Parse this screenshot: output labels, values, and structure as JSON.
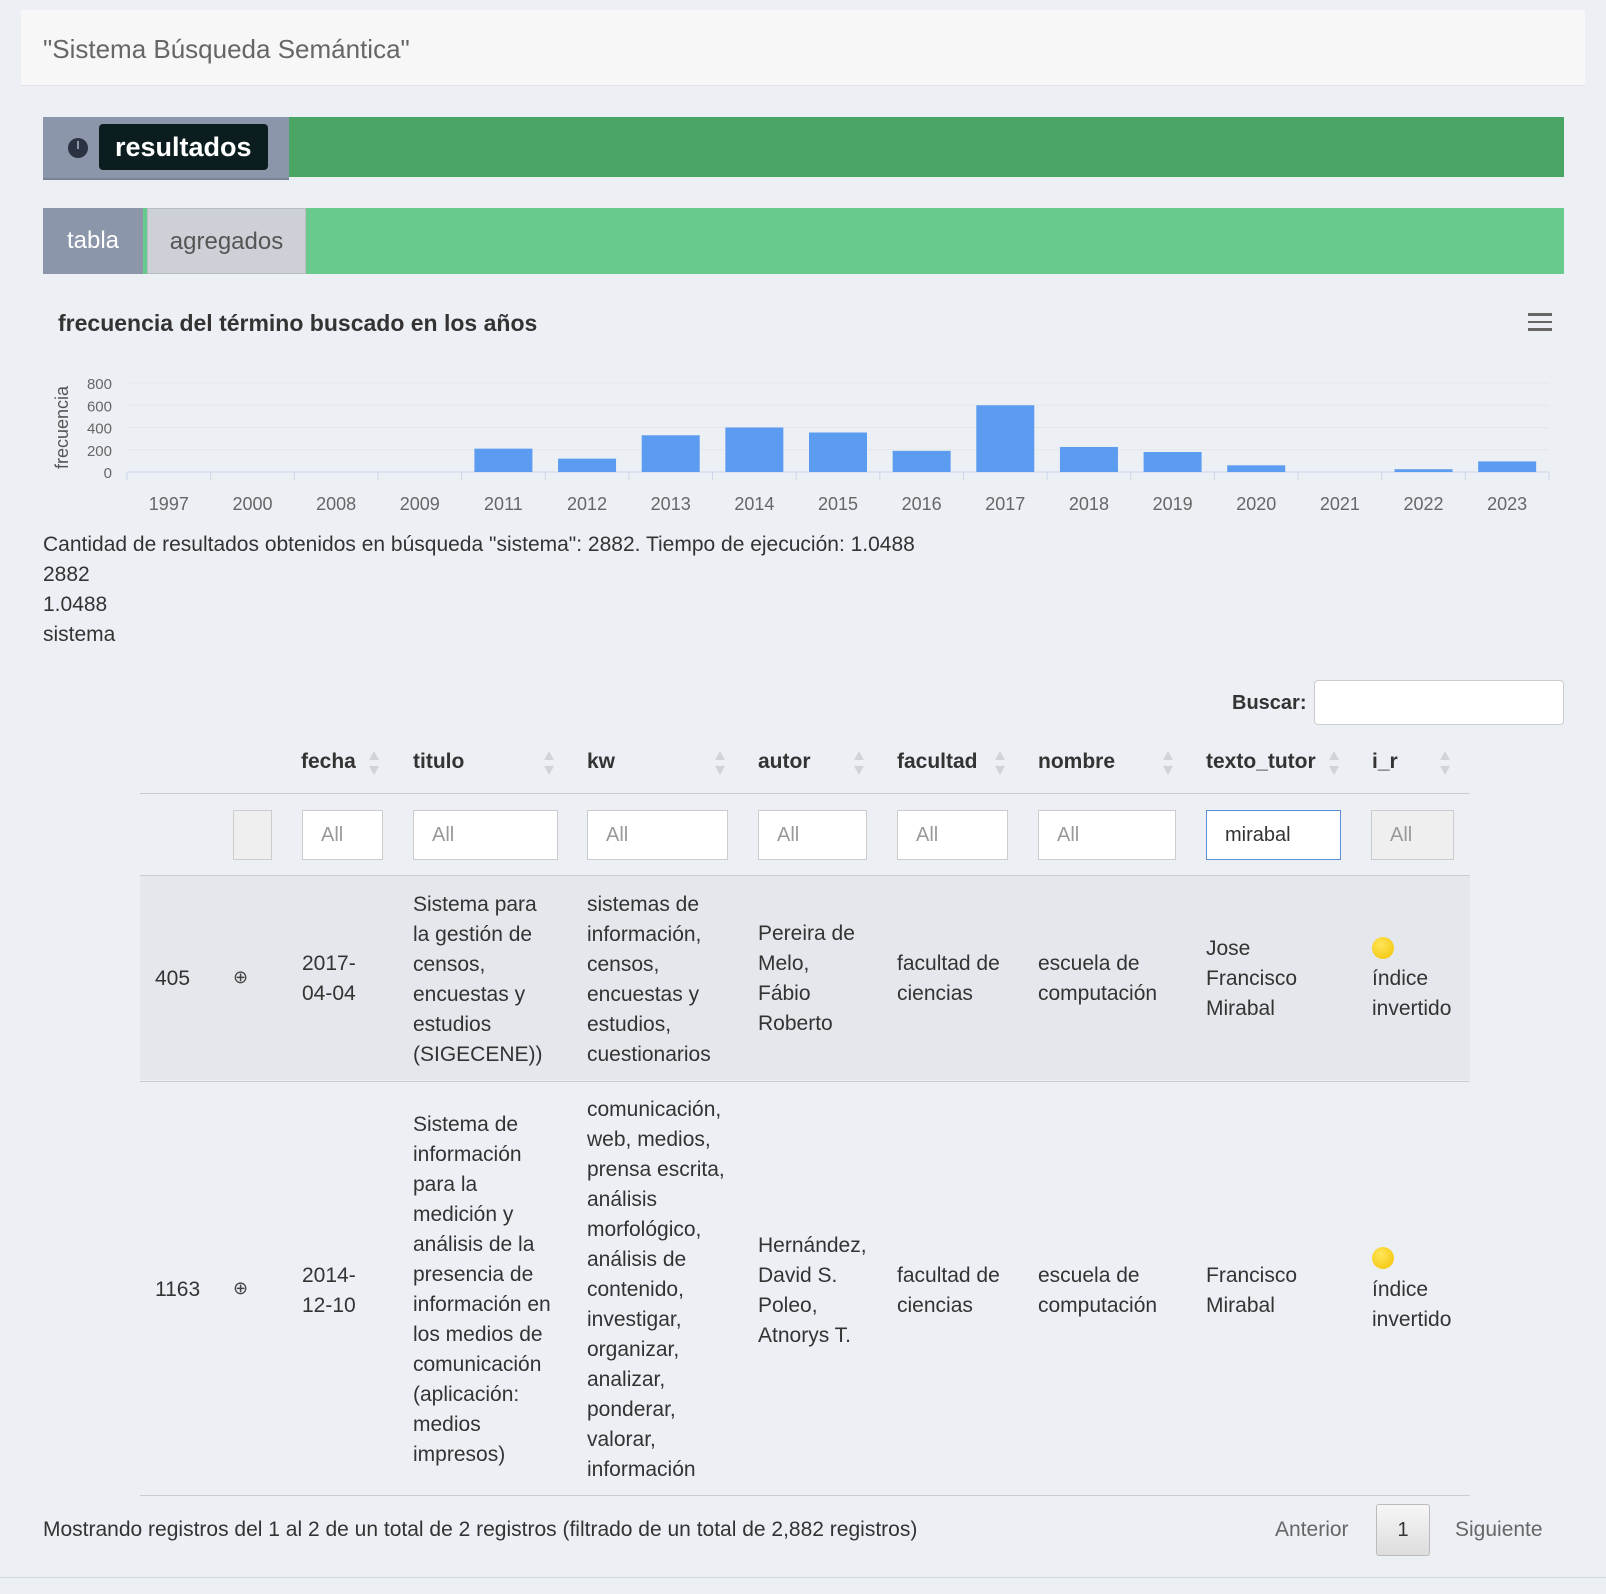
{
  "header": {
    "title": "\"Sistema Búsqueda Semántica\""
  },
  "results_panel": {
    "label": "resultados",
    "icon": "dashboard-icon"
  },
  "tabs": [
    {
      "label": "tabla",
      "active": true
    },
    {
      "label": "agregados",
      "active": false
    }
  ],
  "chart_data": {
    "type": "bar",
    "title": "frecuencia del término buscado en los años",
    "xlabel": "",
    "ylabel": "frecuencia",
    "categories": [
      "1997",
      "2000",
      "2008",
      "2009",
      "2011",
      "2012",
      "2013",
      "2014",
      "2015",
      "2016",
      "2017",
      "2018",
      "2019",
      "2020",
      "2021",
      "2022",
      "2023"
    ],
    "values": [
      0,
      0,
      0,
      0,
      210,
      120,
      330,
      400,
      355,
      190,
      600,
      225,
      180,
      60,
      0,
      25,
      95
    ],
    "ylim": [
      0,
      800
    ],
    "yticks": [
      "0",
      "200",
      "400",
      "600",
      "800"
    ],
    "grid": true,
    "color": "#5b9bf0"
  },
  "summary": {
    "line1": "Cantidad de resultados obtenidos en búsqueda \"sistema\": 2882. Tiempo de ejecución: 1.0488",
    "count": "2882",
    "time": "1.0488",
    "term": "sistema"
  },
  "search": {
    "label": "Buscar:",
    "value": ""
  },
  "table": {
    "columns": [
      "fecha",
      "titulo",
      "kw",
      "autor",
      "facultad",
      "nombre",
      "texto_tutor",
      "i_r"
    ],
    "filters": {
      "fecha": "All",
      "titulo": "All",
      "kw": "All",
      "autor": "All",
      "facultad": "All",
      "nombre": "All",
      "texto_tutor": "mirabal",
      "i_r": "All"
    },
    "rows": [
      {
        "id": "405",
        "expand": "⊕",
        "fecha": [
          "2017-",
          "04-04"
        ],
        "titulo": [
          "Sistema para",
          "la gestión de",
          "censos,",
          "encuestas y",
          "estudios",
          "(SIGECENE))"
        ],
        "kw": [
          "sistemas de",
          "información,",
          "censos,",
          "encuestas y",
          "estudios,",
          "cuestionarios"
        ],
        "autor": [
          "Pereira de",
          "Melo,",
          "Fábio",
          "Roberto"
        ],
        "facultad": [
          "facultad de",
          "ciencias"
        ],
        "nombre": [
          "escuela de",
          "computación"
        ],
        "texto_tutor": [
          "Jose",
          "Francisco",
          "Mirabal"
        ],
        "i_r": [
          "índice",
          "invertido"
        ]
      },
      {
        "id": "1163",
        "expand": "⊕",
        "fecha": [
          "2014-",
          "12-10"
        ],
        "titulo": [
          "Sistema de",
          "información",
          "para la",
          "medición y",
          "análisis de la",
          "presencia de",
          "información en",
          "los medios de",
          "comunicación",
          "(aplicación:",
          "medios",
          "impresos)"
        ],
        "kw": [
          "comunicación,",
          "web, medios,",
          "prensa escrita,",
          "análisis",
          "morfológico,",
          "análisis de",
          "contenido,",
          "investigar,",
          "organizar,",
          "analizar,",
          "ponderar,",
          "valorar,",
          "información"
        ],
        "autor": [
          "Hernández,",
          "David S.",
          "Poleo,",
          "Atnorys T."
        ],
        "facultad": [
          "facultad de",
          "ciencias"
        ],
        "nombre": [
          "escuela de",
          "computación"
        ],
        "texto_tutor": [
          "Francisco",
          "Mirabal"
        ],
        "i_r": [
          "índice",
          "invertido"
        ]
      }
    ]
  },
  "footer": {
    "info": "Mostrando registros del 1 al 2 de un total de 2 registros (filtrado de un total de 2,882 registros)",
    "prev": "Anterior",
    "page": "1",
    "next": "Siguiente"
  }
}
